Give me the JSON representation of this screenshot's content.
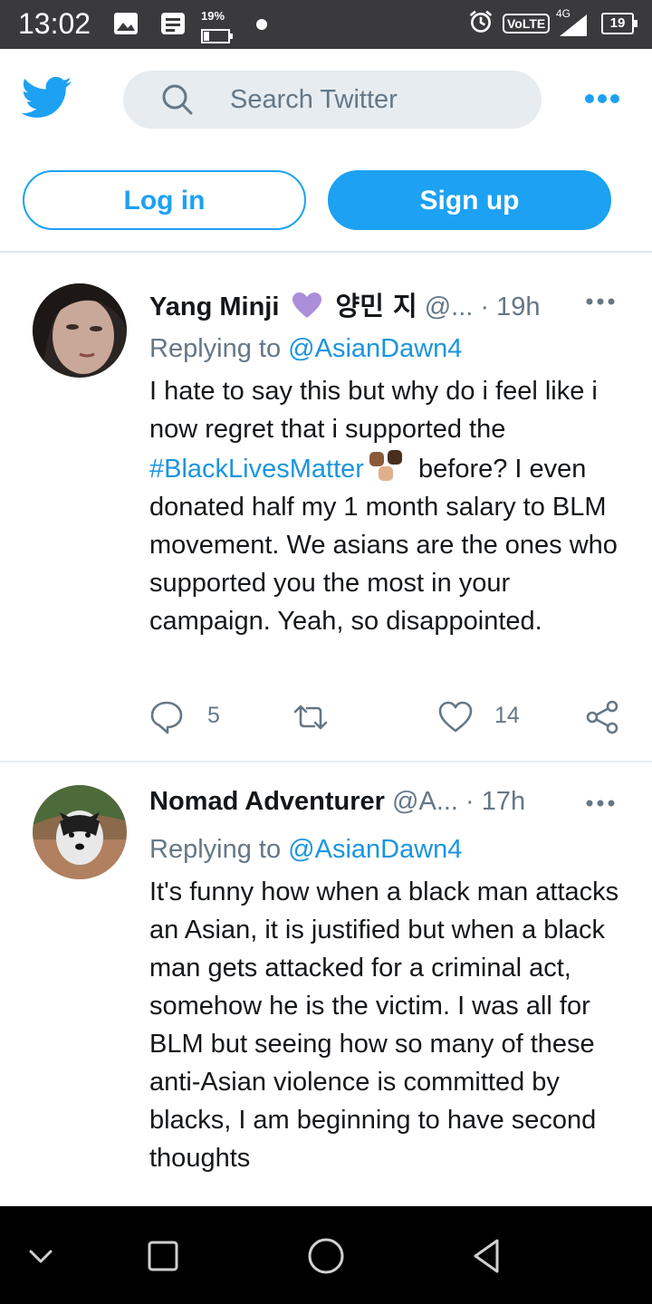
{
  "status_bar": {
    "time": "13:02",
    "battery_small_pct": "19%",
    "volte": "VoLTE",
    "network": "4G",
    "battery": "19"
  },
  "header": {
    "search_placeholder": "Search Twitter",
    "login_label": "Log in",
    "signup_label": "Sign up"
  },
  "colors": {
    "accent": "#1da1f2",
    "link": "#1b95e0",
    "muted": "#657786"
  },
  "tweets": [
    {
      "name": "Yang Minji",
      "korean": "양민 지",
      "handle": "@...",
      "time": "· 19h",
      "reply_prefix": "Replying to",
      "reply_to": "@AsianDawn4",
      "text_a": "I hate to say this but why do i feel like i now regret that i supported the",
      "hashtag": "#BlackLivesMatter",
      "text_b": "before? I even donated half my 1 month salary to BLM movement. We asians are the ones who supported you the most in your campaign.  Yeah, so disappointed.",
      "replies": "5",
      "likes": "14"
    },
    {
      "name": "Nomad Adventurer",
      "handle": "@A...",
      "time": "· 17h",
      "reply_prefix": "Replying to",
      "reply_to": "@AsianDawn4",
      "text": "It's funny how when a black man attacks an Asian, it is justified but when a black man gets attacked for a criminal act, somehow he is the victim.  I was all for BLM but seeing how so many of these anti-Asian violence is committed by blacks, I am beginning to have second thoughts"
    }
  ]
}
